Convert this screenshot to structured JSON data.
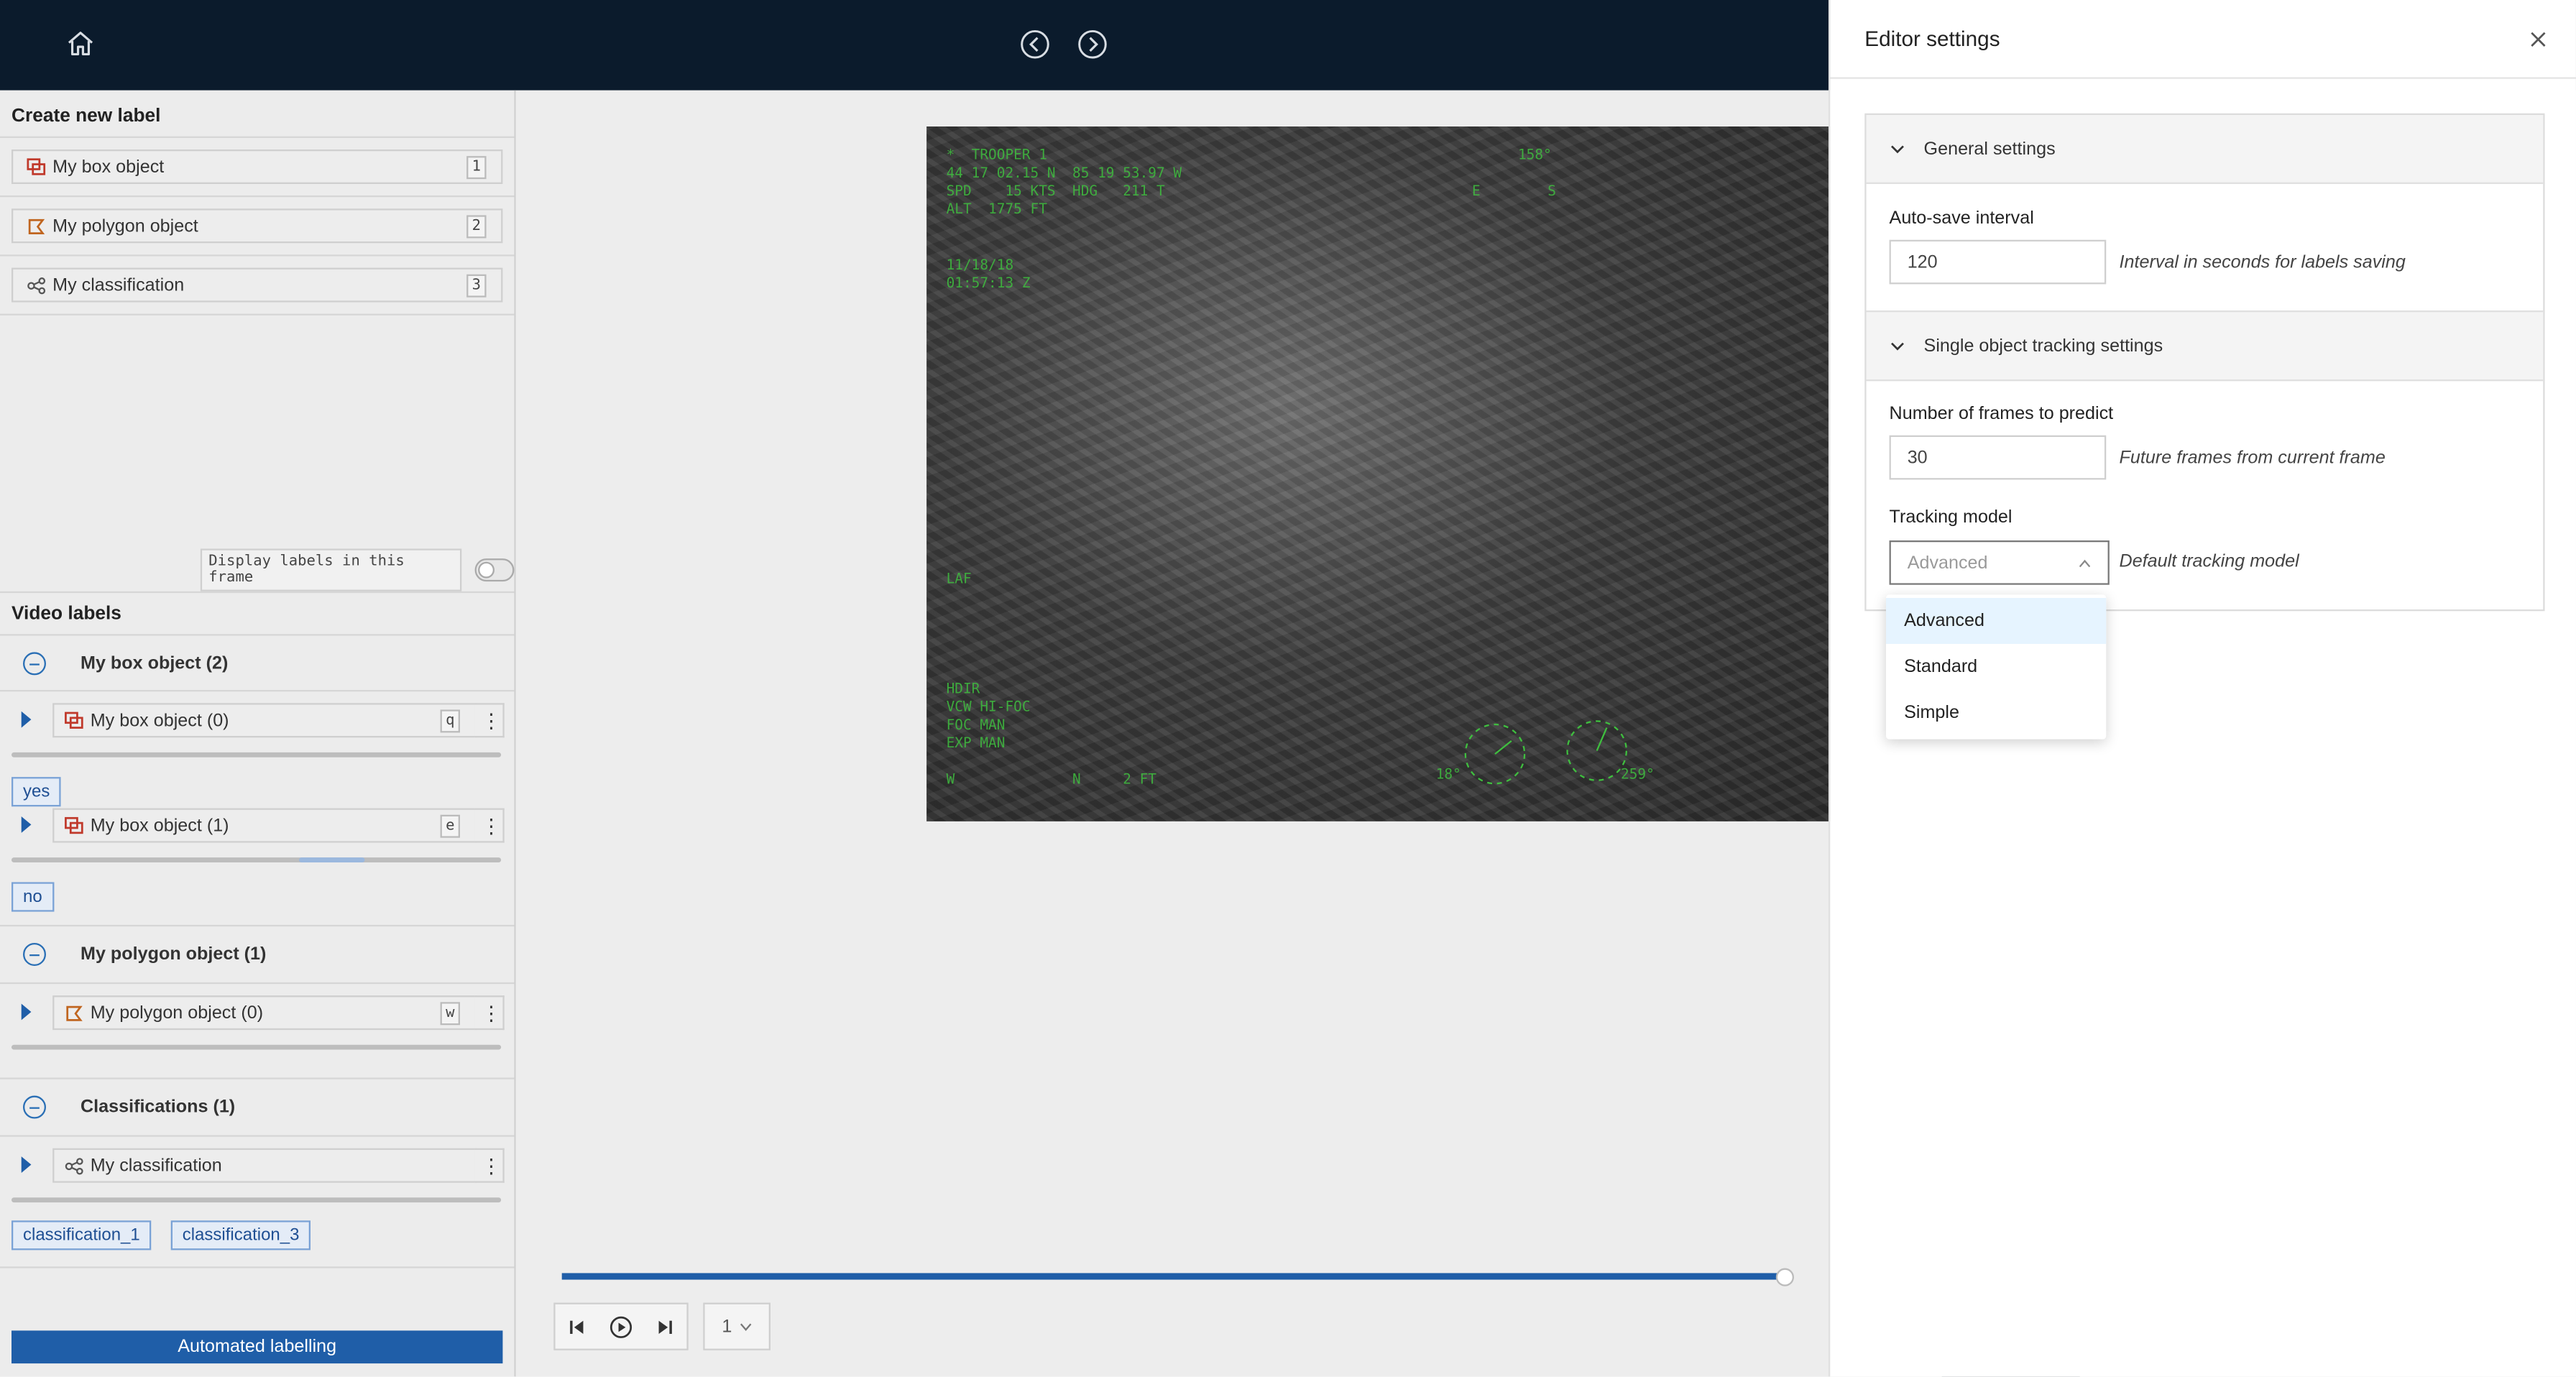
{
  "left_panel": {
    "create_title": "Create new label",
    "create_items": [
      {
        "label": "My box object",
        "hotkey": "1"
      },
      {
        "label": "My polygon object",
        "hotkey": "2"
      },
      {
        "label": "My classification",
        "hotkey": "3"
      }
    ],
    "display_toggle_label": "Display labels in this frame",
    "video_labels_title": "Video labels",
    "groups": {
      "box_group": "My box object (2)",
      "box_0": {
        "label": "My box object (0)",
        "hotkey": "q",
        "tag": "yes"
      },
      "box_1": {
        "label": "My box object (1)",
        "hotkey": "e",
        "tag": "no"
      },
      "polygon_group": "My polygon object (1)",
      "polygon_0": {
        "label": "My polygon object (0)",
        "hotkey": "w"
      },
      "class_group": "Classifications (1)",
      "class_0": {
        "label": "My classification",
        "tags": [
          "classification_1",
          "classification_3"
        ]
      }
    },
    "automated_button": "Automated labelling"
  },
  "player": {
    "frame_number": "1",
    "progress": 1.0
  },
  "hud": {
    "top_left": "*  TROOPER 1\n44 17 02.15 N  85 19 53.97 W\nSPD    15 KTS  HDG   211 T\nALT  1775 FT",
    "date": "11/18/18\n01:57:13 Z",
    "heading": "158°",
    "compass": "E        S",
    "mid_left": "LAF",
    "bottom_left": "HDIR\nVCW HI-FOC\nFOC MAN\nEXP MAN",
    "bottom_scale": "W              N     2 FT",
    "bottom_right": "18°                   259°"
  },
  "editor": {
    "title": "Editor settings",
    "general_title": "General settings",
    "autosave_label": "Auto-save interval",
    "autosave_value": "120",
    "autosave_help": "Interval in seconds for labels saving",
    "tracking_title": "Single object tracking settings",
    "frames_label": "Number of frames to predict",
    "frames_value": "30",
    "frames_help": "Future frames from current frame",
    "model_label": "Tracking model",
    "model_value": "Advanced",
    "model_help": "Default tracking model",
    "model_options": [
      "Advanced",
      "Standard",
      "Simple"
    ]
  },
  "colors": {
    "topbar": "#0b1b2c",
    "accent": "#1f5ea8",
    "box_icon": "#c0392b",
    "polygon_icon": "#c0651f",
    "hud_green": "#3fbf3f"
  }
}
